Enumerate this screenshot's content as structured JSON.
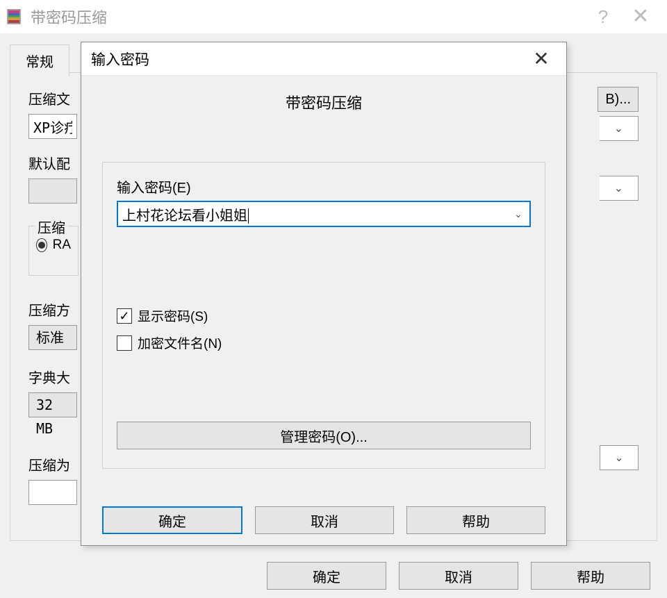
{
  "parent": {
    "title": "带密码压缩",
    "tab": "常规",
    "archive_label": "压缩文",
    "archive_value": "XP诊疗",
    "browse_button": "B)...",
    "profile_label": "默认配",
    "format_group": "压缩",
    "format_rar": "RA",
    "method_label": "压缩方",
    "method_value": "标准",
    "dict_label": "字典大",
    "dict_value": "32 MB",
    "split_label": "压缩为",
    "split_value": "",
    "ok": "确定",
    "cancel": "取消",
    "help": "帮助"
  },
  "modal": {
    "title": "输入密码",
    "heading": "带密码压缩",
    "password_label": "输入密码(E)",
    "password_value": "上村花论坛看小姐姐",
    "show_password": "显示密码(S)",
    "show_password_checked": true,
    "encrypt_names": "加密文件名(N)",
    "encrypt_names_checked": false,
    "manage_passwords": "管理密码(O)...",
    "ok": "确定",
    "cancel": "取消",
    "help": "帮助"
  }
}
